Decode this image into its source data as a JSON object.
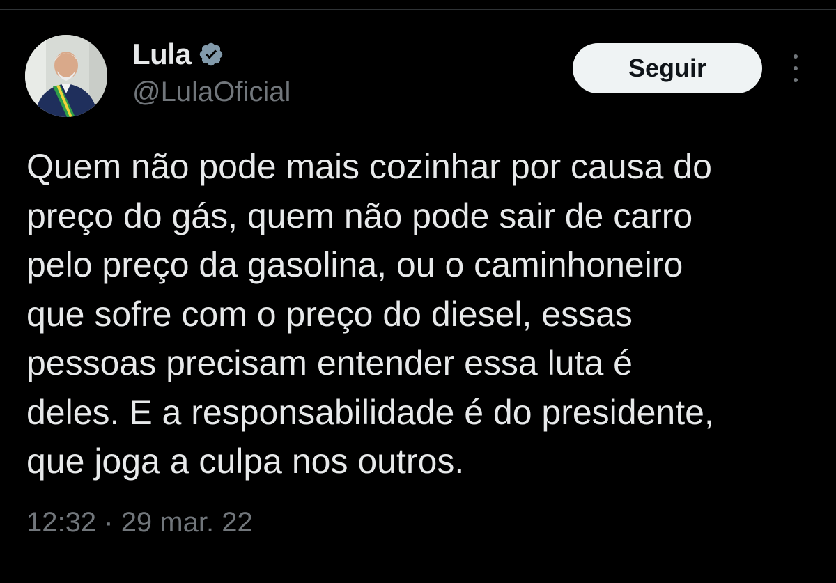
{
  "tweet": {
    "author": {
      "display_name": "Lula",
      "handle": "@LulaOficial",
      "verified_icon": "verified-badge-icon",
      "avatar": "avatar-photo"
    },
    "follow_label": "Seguir",
    "more_icon": "more-options-icon",
    "text": "Quem não pode mais cozinhar por causa do\npreço do gás, quem não pode sair de carro\npelo preço da gasolina, ou o caminhoneiro\nque sofre com o preço do diesel, essas\npessoas precisam entender essa luta é\ndeles. E a responsabilidade é do presidente,\nque joga a culpa nos outros.",
    "time": "12:32",
    "separator": "·",
    "date": "29 mar. 22"
  },
  "colors": {
    "background": "#000000",
    "text_primary": "#e7e9ea",
    "text_secondary": "#71767b",
    "button_bg": "#eff3f4",
    "button_text": "#0f1419",
    "divider": "#2f3336",
    "verified_badge": "#829aab"
  }
}
